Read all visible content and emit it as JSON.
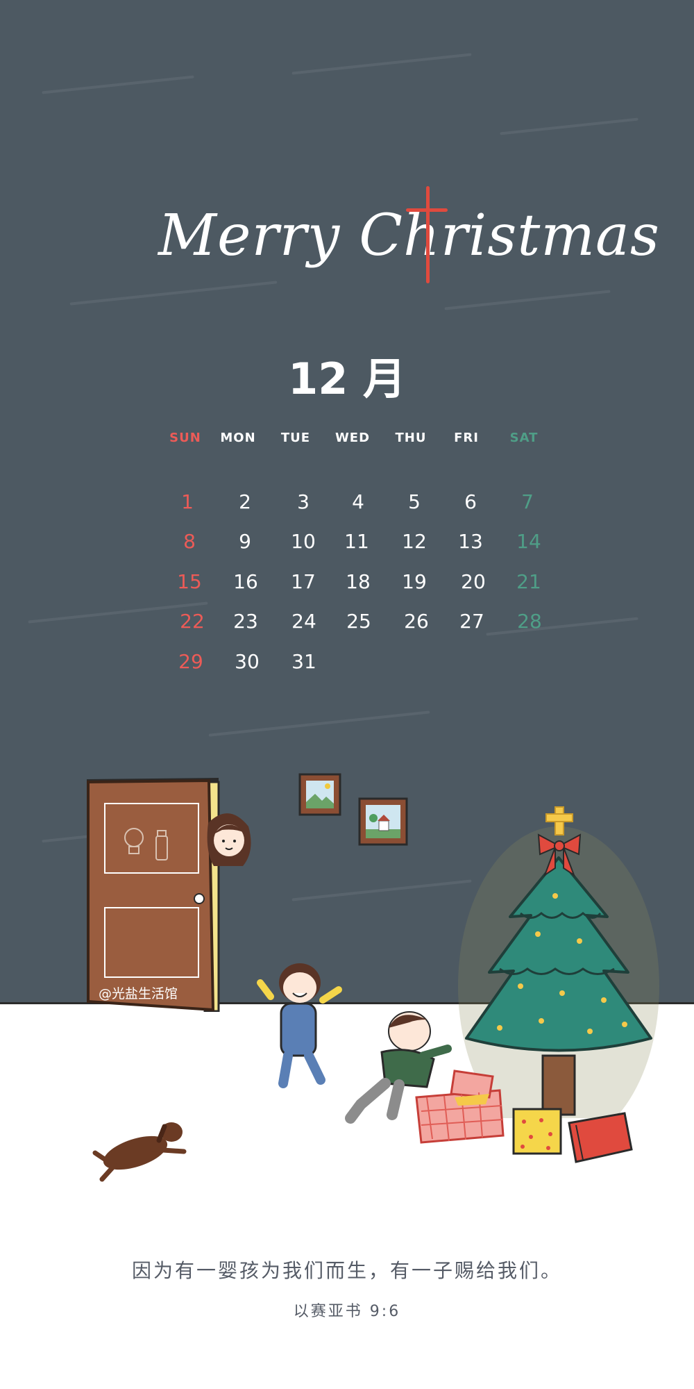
{
  "header": {
    "title": "Merry Christmas"
  },
  "calendar": {
    "month_label": "12 月",
    "weekdays": [
      "SUN",
      "MON",
      "TUE",
      "WED",
      "THU",
      "FRI",
      "SAT"
    ],
    "weeks": [
      [
        "1",
        "2",
        "3",
        "4",
        "5",
        "6",
        "7"
      ],
      [
        "8",
        "9",
        "10",
        "11",
        "12",
        "13",
        "14"
      ],
      [
        "15",
        "16",
        "17",
        "18",
        "19",
        "20",
        "21"
      ],
      [
        "22",
        "23",
        "24",
        "25",
        "26",
        "27",
        "28"
      ],
      [
        "29",
        "30",
        "31",
        "",
        "",
        "",
        ""
      ]
    ]
  },
  "illustration": {
    "watermark": "@光盐生活馆",
    "icons": [
      "door-icon",
      "lightbulb-icon",
      "salt-shaker-icon",
      "picture-frame-icon",
      "christmas-tree-icon",
      "gift-box-icon",
      "dog-icon"
    ]
  },
  "footer": {
    "verse": "因为有一婴孩为我们而生，有一子赐给我们。",
    "reference": "以赛亚书 9:6"
  },
  "colors": {
    "board": "#4d5962",
    "sunday": "#ec5b57",
    "saturday": "#4f9e87",
    "cross": "#e04a3e",
    "tree": "#2f8a7a"
  }
}
